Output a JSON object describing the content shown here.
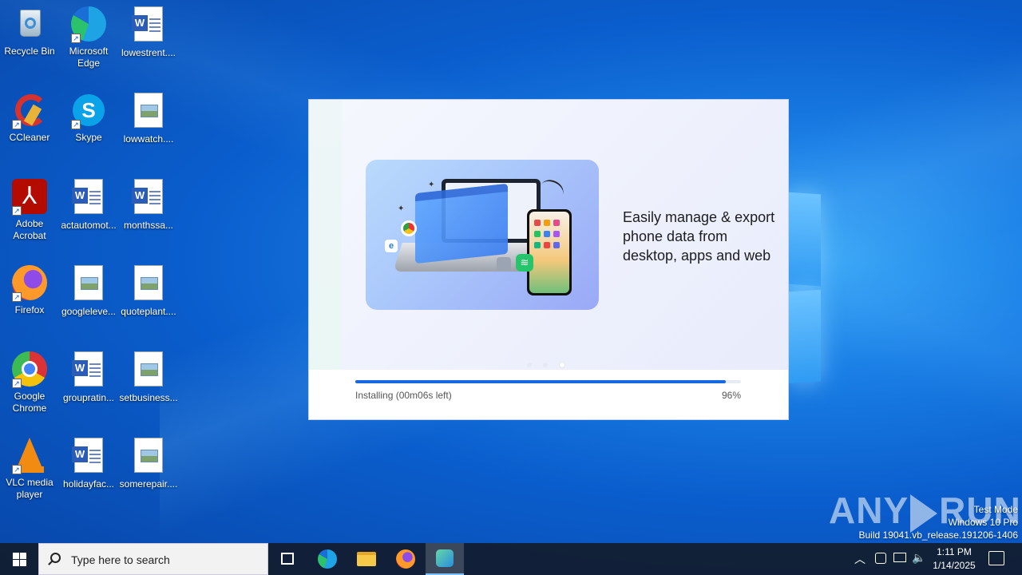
{
  "desktop": {
    "icons": [
      {
        "label": "Recycle Bin",
        "icon": "recycle-bin-icon"
      },
      {
        "label": "Microsoft Edge",
        "icon": "edge-icon"
      },
      {
        "label": "lowestrent....",
        "icon": "word-doc-icon"
      },
      {
        "label": "CCleaner",
        "icon": "ccleaner-icon"
      },
      {
        "label": "Skype",
        "icon": "skype-icon"
      },
      {
        "label": "lowwatch....",
        "icon": "image-doc-icon"
      },
      {
        "label": "Adobe Acrobat",
        "icon": "acrobat-icon"
      },
      {
        "label": "actautomot...",
        "icon": "word-doc-icon"
      },
      {
        "label": "monthssa...",
        "icon": "word-doc-icon"
      },
      {
        "label": "Firefox",
        "icon": "firefox-icon"
      },
      {
        "label": "googleleve...",
        "icon": "image-doc-icon"
      },
      {
        "label": "quoteplant....",
        "icon": "image-doc-icon"
      },
      {
        "label": "Google Chrome",
        "icon": "chrome-icon"
      },
      {
        "label": "groupratin...",
        "icon": "word-doc-icon"
      },
      {
        "label": "setbusiness...",
        "icon": "image-doc-icon"
      },
      {
        "label": "VLC media player",
        "icon": "vlc-icon"
      },
      {
        "label": "holidayfac...",
        "icon": "word-doc-icon"
      },
      {
        "label": "somerepair....",
        "icon": "image-doc-icon"
      }
    ]
  },
  "installer": {
    "promo_text_line1": "Easily manage & export",
    "promo_text_line2": "phone data from",
    "promo_text_line3": "desktop, apps and web",
    "status": "Installing (00m06s left)",
    "percent_label": "96%",
    "progress": 0.96,
    "carousel_pages": 3,
    "carousel_active": 3
  },
  "watermark": {
    "brand_left": "ANY",
    "brand_right": "RUN",
    "line1": "Test Mode",
    "line2": "Windows 10 Pro",
    "line3": "Build 19041.vb_release.191206-1406"
  },
  "taskbar": {
    "search_placeholder": "Type here to search",
    "time": "1:11 PM",
    "date": "1/14/2025"
  },
  "colors": {
    "accent": "#1668e3",
    "taskbar": "#121c2c"
  }
}
